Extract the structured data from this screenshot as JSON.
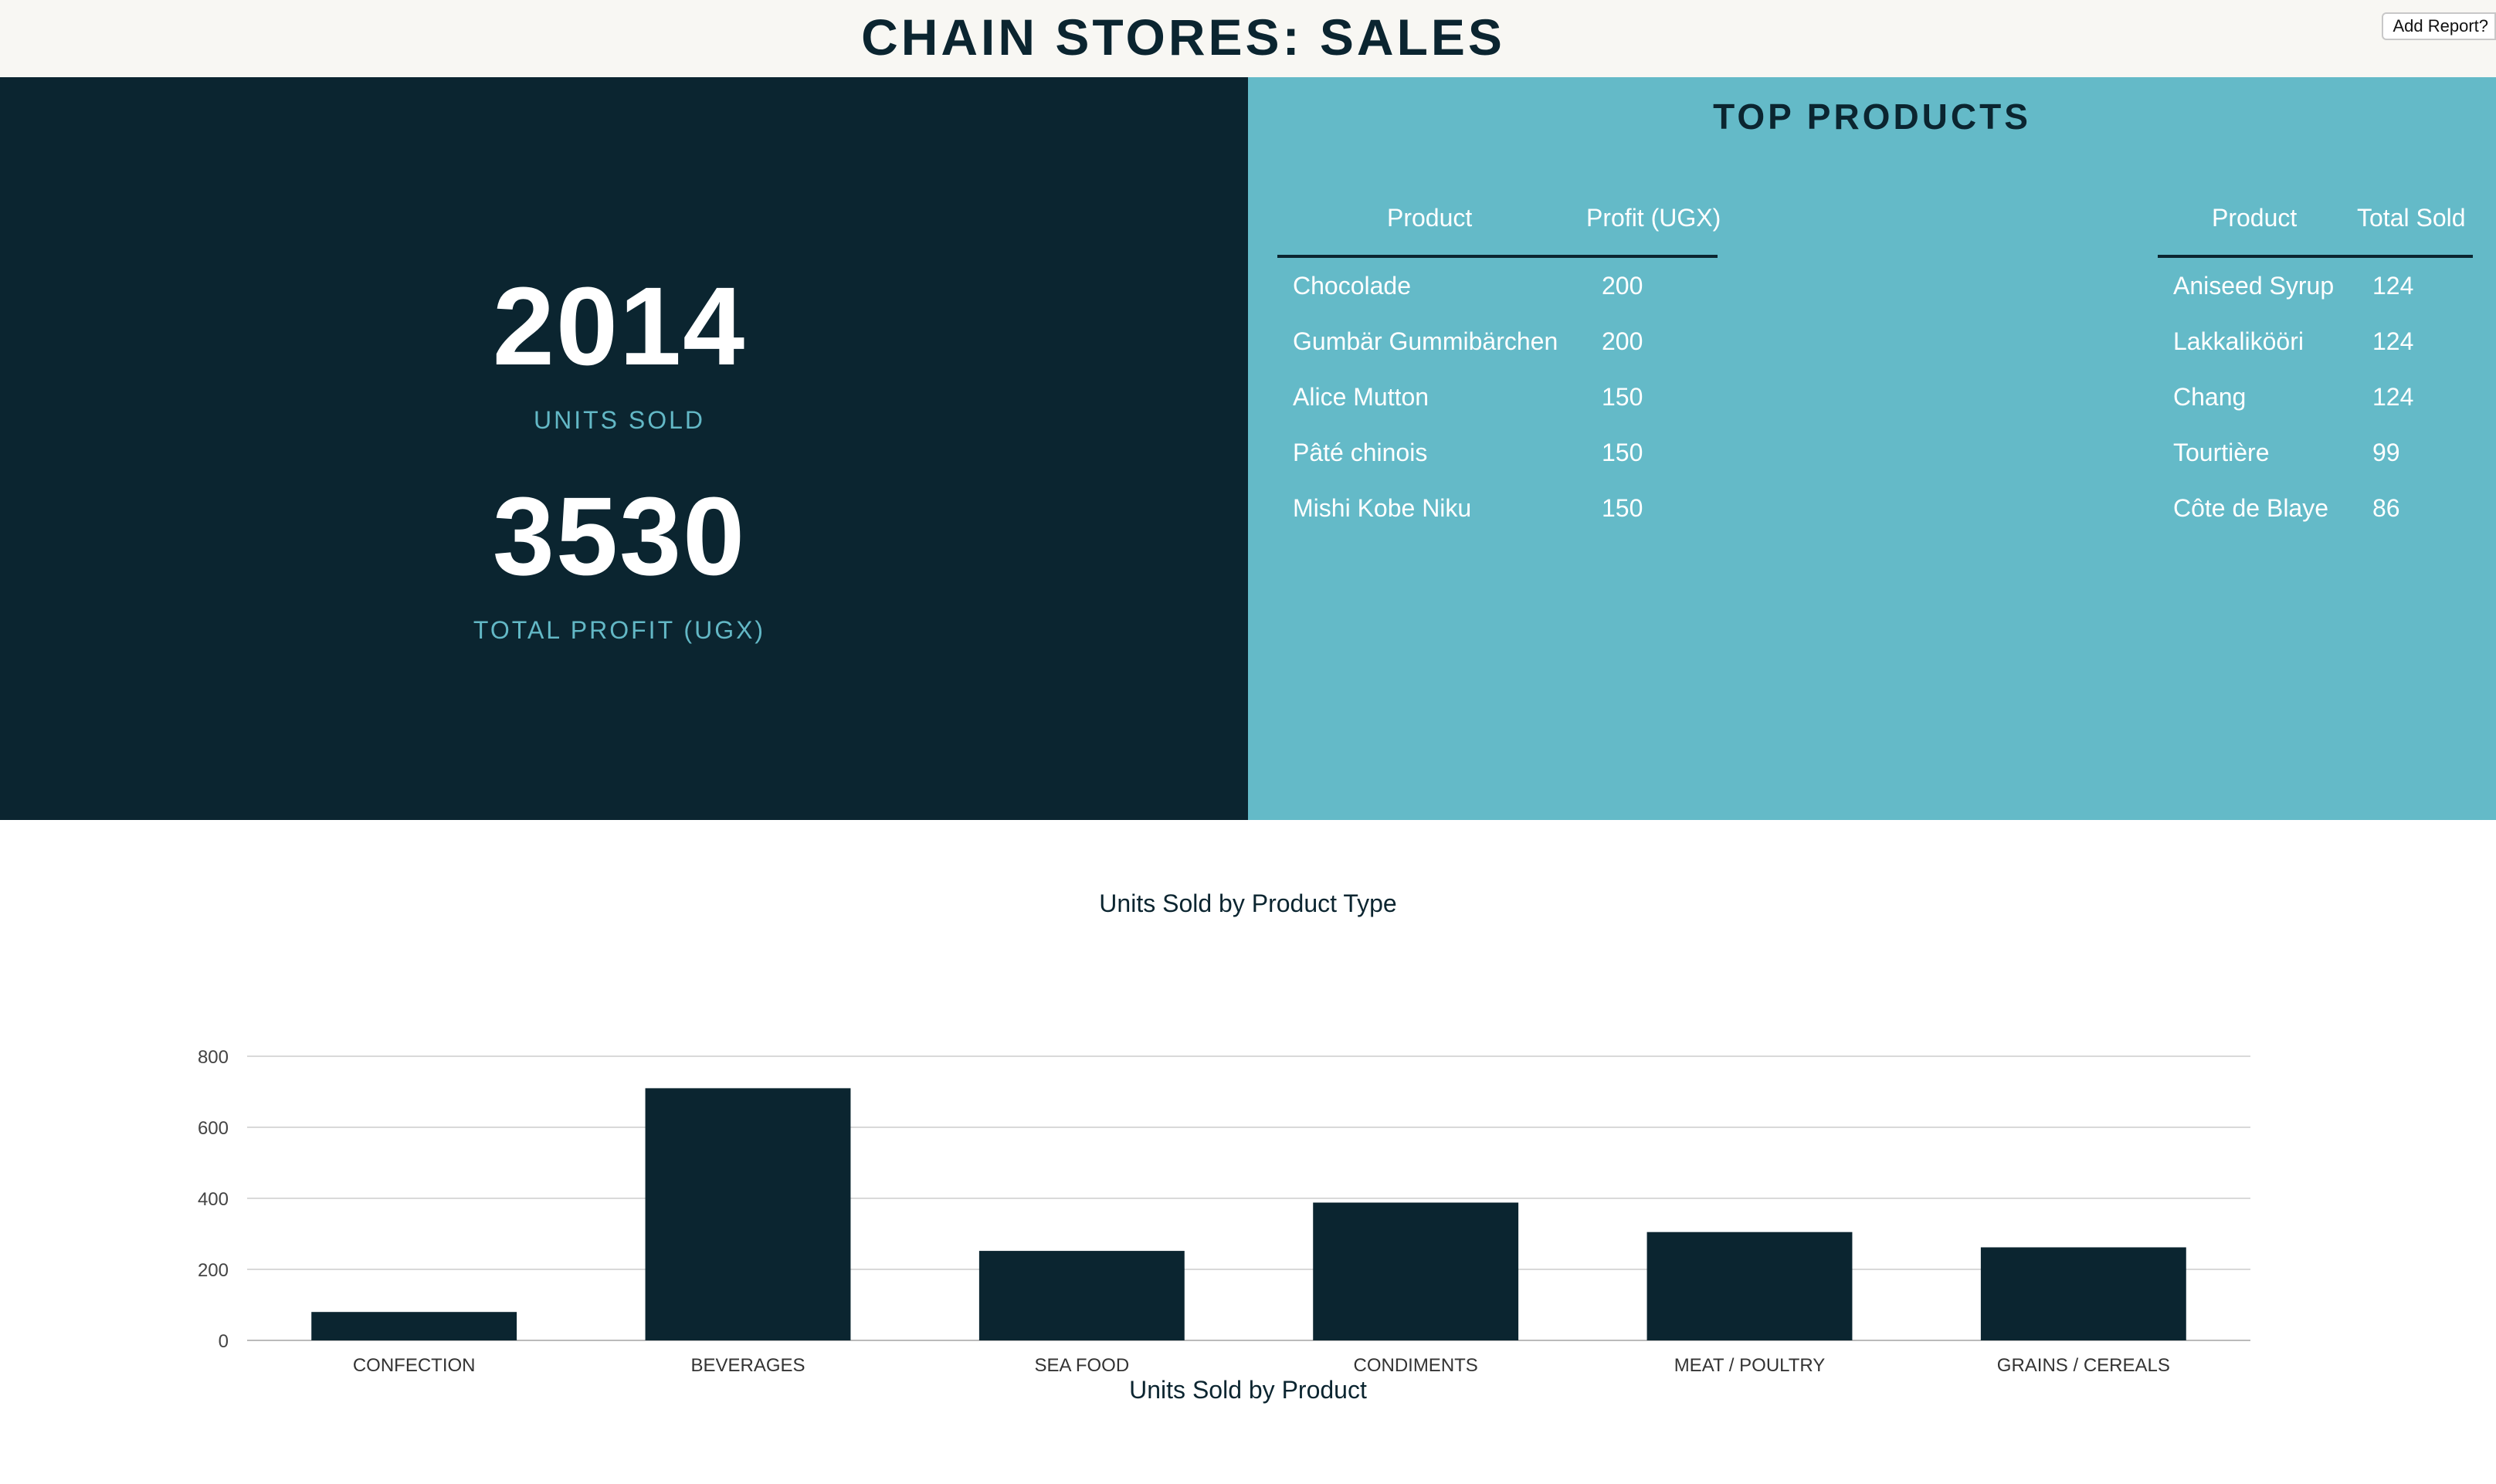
{
  "header": {
    "title": "CHAIN STORES: SALES",
    "add_report_label": "Add Report?"
  },
  "stats": {
    "units_sold_value": "2014",
    "units_sold_label": "UNITS SOLD",
    "total_profit_value": "3530",
    "total_profit_label": "TOTAL PROFIT (UGX)"
  },
  "top_products": {
    "title": "TOP PRODUCTS",
    "by_profit": {
      "columns": [
        "Product",
        "Profit (UGX)"
      ],
      "rows": [
        {
          "product": "Chocolade",
          "value": "200"
        },
        {
          "product": "Gumbär Gummibärchen",
          "value": "200"
        },
        {
          "product": "Alice Mutton",
          "value": "150"
        },
        {
          "product": "Pâté chinois",
          "value": "150"
        },
        {
          "product": "Mishi Kobe Niku",
          "value": "150"
        }
      ]
    },
    "by_units": {
      "columns": [
        "Product",
        "Total Sold"
      ],
      "rows": [
        {
          "product": "Aniseed Syrup",
          "value": "124"
        },
        {
          "product": "Lakkalikööri",
          "value": "124"
        },
        {
          "product": "Chang",
          "value": "124"
        },
        {
          "product": "Tourtière",
          "value": "99"
        },
        {
          "product": "Côte de Blaye",
          "value": "86"
        }
      ]
    }
  },
  "chart_data": {
    "type": "bar",
    "title": "Units Sold by Product Type",
    "categories": [
      "CONFECTION",
      "BEVERAGES",
      "SEA FOOD",
      "CONDIMENTS",
      "MEAT / POULTRY",
      "GRAINS / CEREALS"
    ],
    "values": [
      80,
      710,
      252,
      388,
      305,
      262
    ],
    "ylim": [
      0,
      800
    ],
    "yticks": [
      0,
      200,
      400,
      600,
      800
    ],
    "xlabel": "",
    "ylabel": "",
    "grid": true,
    "bar_color": "#0b2530"
  },
  "next_section": {
    "title": "Units Sold by Product"
  },
  "colors": {
    "dark": "#0b2530",
    "accent": "#64bac8",
    "header_bg": "#f8f7f3"
  }
}
